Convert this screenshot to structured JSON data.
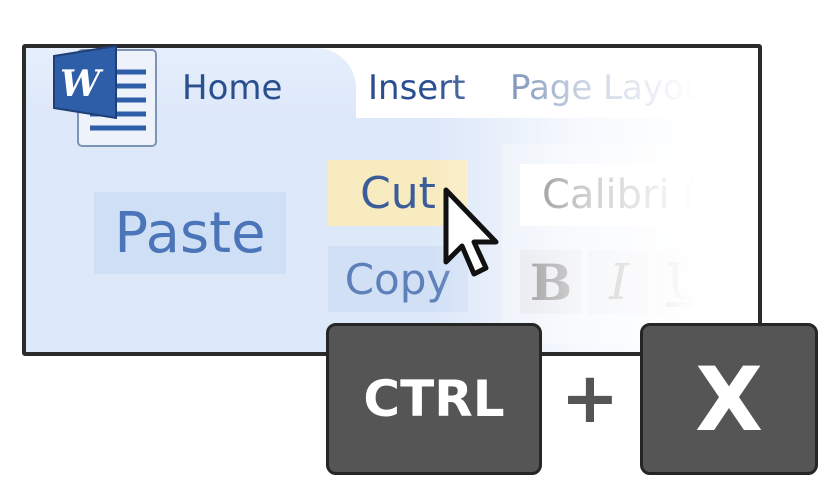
{
  "ribbon": {
    "tabs": [
      {
        "label": "Home",
        "active": true
      },
      {
        "label": "Insert",
        "active": false
      },
      {
        "label": "Page Layou",
        "active": false
      }
    ],
    "clipboard": {
      "paste_label": "Paste",
      "cut_label": "Cut",
      "copy_label": "Copy"
    },
    "font": {
      "font_name": "Calibri (B",
      "bold_label": "B",
      "italic_label": "I",
      "underline_label": "U"
    },
    "app_logo": {
      "icon": "word-logo-icon",
      "letter": "W"
    }
  },
  "shortcut": {
    "key1": "CTRL",
    "plus": "+",
    "key2": "X"
  },
  "colors": {
    "tab_text": "#2a4f8e",
    "ribbon_bg": "#dde8f9",
    "cut_highlight": "#f9ebc0",
    "key_bg": "#555555",
    "window_border": "#2b2b2b"
  }
}
